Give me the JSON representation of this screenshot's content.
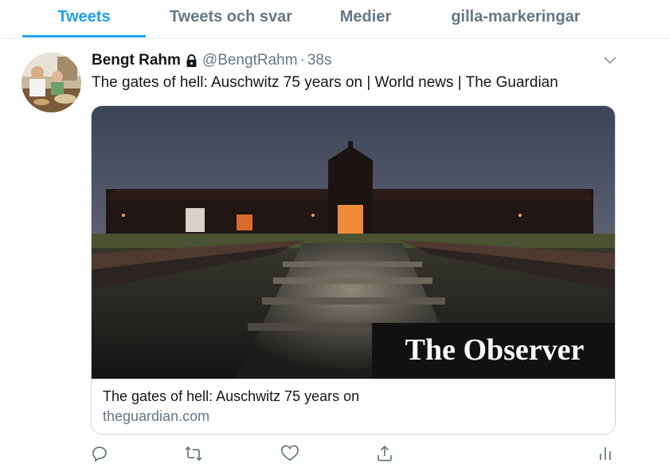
{
  "tabs": [
    {
      "label": "Tweets",
      "active": true
    },
    {
      "label": "Tweets och svar",
      "active": false
    },
    {
      "label": "Medier",
      "active": false
    },
    {
      "label": "gilla-markeringar",
      "active": false
    }
  ],
  "tweet": {
    "author_name": "Bengt Rahm",
    "handle": "@BengtRahm",
    "separator": "·",
    "time": "38s",
    "text": "The gates of hell: Auschwitz 75 years on | World news | The Guardian",
    "card": {
      "image_overlay_text": "The Observer",
      "title": "The gates of hell: Auschwitz 75 years on",
      "domain": "theguardian.com"
    },
    "actions": [
      "reply-icon",
      "retweet-icon",
      "like-icon",
      "share-icon",
      "analytics-icon"
    ]
  },
  "colors": {
    "accent": "#1da1f2",
    "secondary_text": "#657786",
    "border": "#e6ecf0"
  }
}
